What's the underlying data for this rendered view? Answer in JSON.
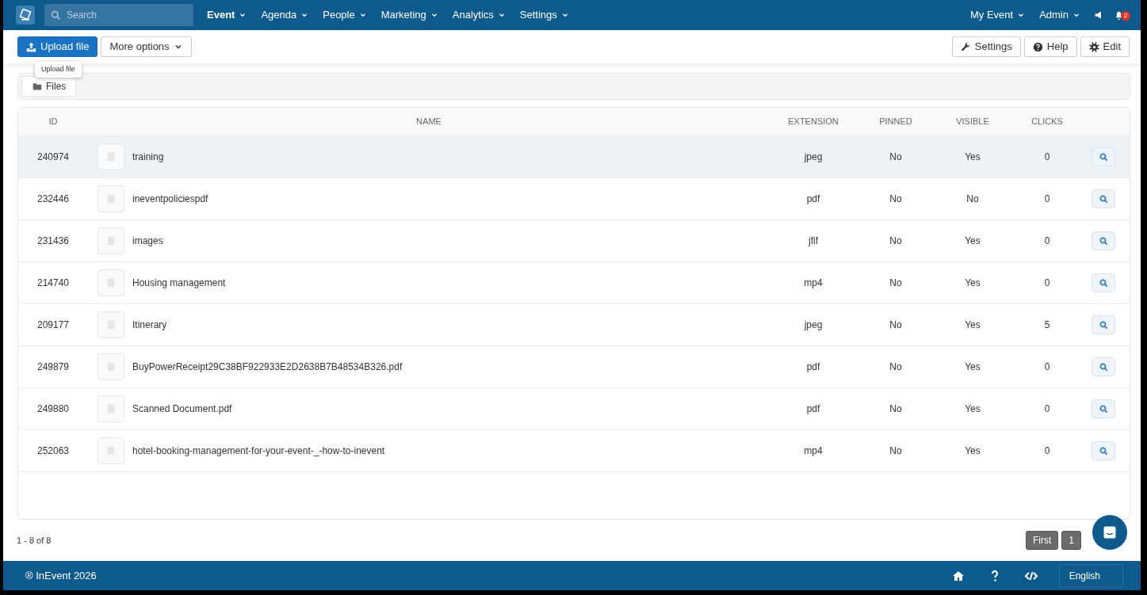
{
  "navbar": {
    "search": {
      "placeholder": "Search"
    },
    "menu": [
      {
        "label": "Event",
        "selected": true
      },
      {
        "label": "Agenda",
        "selected": false
      },
      {
        "label": "People",
        "selected": false
      },
      {
        "label": "Marketing",
        "selected": false
      },
      {
        "label": "Analytics",
        "selected": false
      },
      {
        "label": "Settings",
        "selected": false
      }
    ],
    "right_menu": [
      "My Event",
      "Admin"
    ],
    "notification_count": "2"
  },
  "toolbar": {
    "left_buttons": [
      {
        "kind": "primary",
        "label": "Upload file"
      },
      {
        "kind": "dropdown",
        "label": "More options"
      }
    ],
    "right_buttons": [
      {
        "kind": "wrench",
        "label": "Settings"
      },
      {
        "kind": "help",
        "label": "Help"
      },
      {
        "kind": "gear",
        "label": "Edit"
      }
    ]
  },
  "tooltip": "Upload file",
  "tabs": [
    {
      "label": "Files",
      "selected": true
    }
  ],
  "table": {
    "columns": [
      "ID",
      "NAME",
      "EXTENSION",
      "PINNED",
      "VISIBLE",
      "CLICKS"
    ],
    "rows": [
      {
        "id": "240974",
        "name": "training",
        "extension": "jpeg",
        "pinned": "No",
        "visible": "Yes",
        "clicks": "0",
        "hovered": true
      },
      {
        "id": "232446",
        "name": "ineventpoliciespdf",
        "extension": "pdf",
        "pinned": "No",
        "visible": "No",
        "clicks": "0",
        "hovered": false
      },
      {
        "id": "231436",
        "name": "images",
        "extension": "jfif",
        "pinned": "No",
        "visible": "Yes",
        "clicks": "0",
        "hovered": false
      },
      {
        "id": "214740",
        "name": "Housing management",
        "extension": "mp4",
        "pinned": "No",
        "visible": "Yes",
        "clicks": "0",
        "hovered": false
      },
      {
        "id": "209177",
        "name": "Itinerary",
        "extension": "jpeg",
        "pinned": "No",
        "visible": "Yes",
        "clicks": "5",
        "hovered": false
      },
      {
        "id": "249879",
        "name": "BuyPowerReceipt29C38BF922933E2D2638B7B48534B326.pdf",
        "extension": "pdf",
        "pinned": "No",
        "visible": "Yes",
        "clicks": "0",
        "hovered": false
      },
      {
        "id": "249880",
        "name": "Scanned Document.pdf",
        "extension": "pdf",
        "pinned": "No",
        "visible": "Yes",
        "clicks": "0",
        "hovered": false
      },
      {
        "id": "252063",
        "name": "hotel-booking-management-for-your-event-_-how-to-inevent",
        "extension": "mp4",
        "pinned": "No",
        "visible": "Yes",
        "clicks": "0",
        "hovered": false
      }
    ]
  },
  "range": "1 - 8 of 8",
  "pagination": [
    "First",
    "1"
  ],
  "footer": {
    "copyright": "® InEvent 2026",
    "language": "English"
  }
}
